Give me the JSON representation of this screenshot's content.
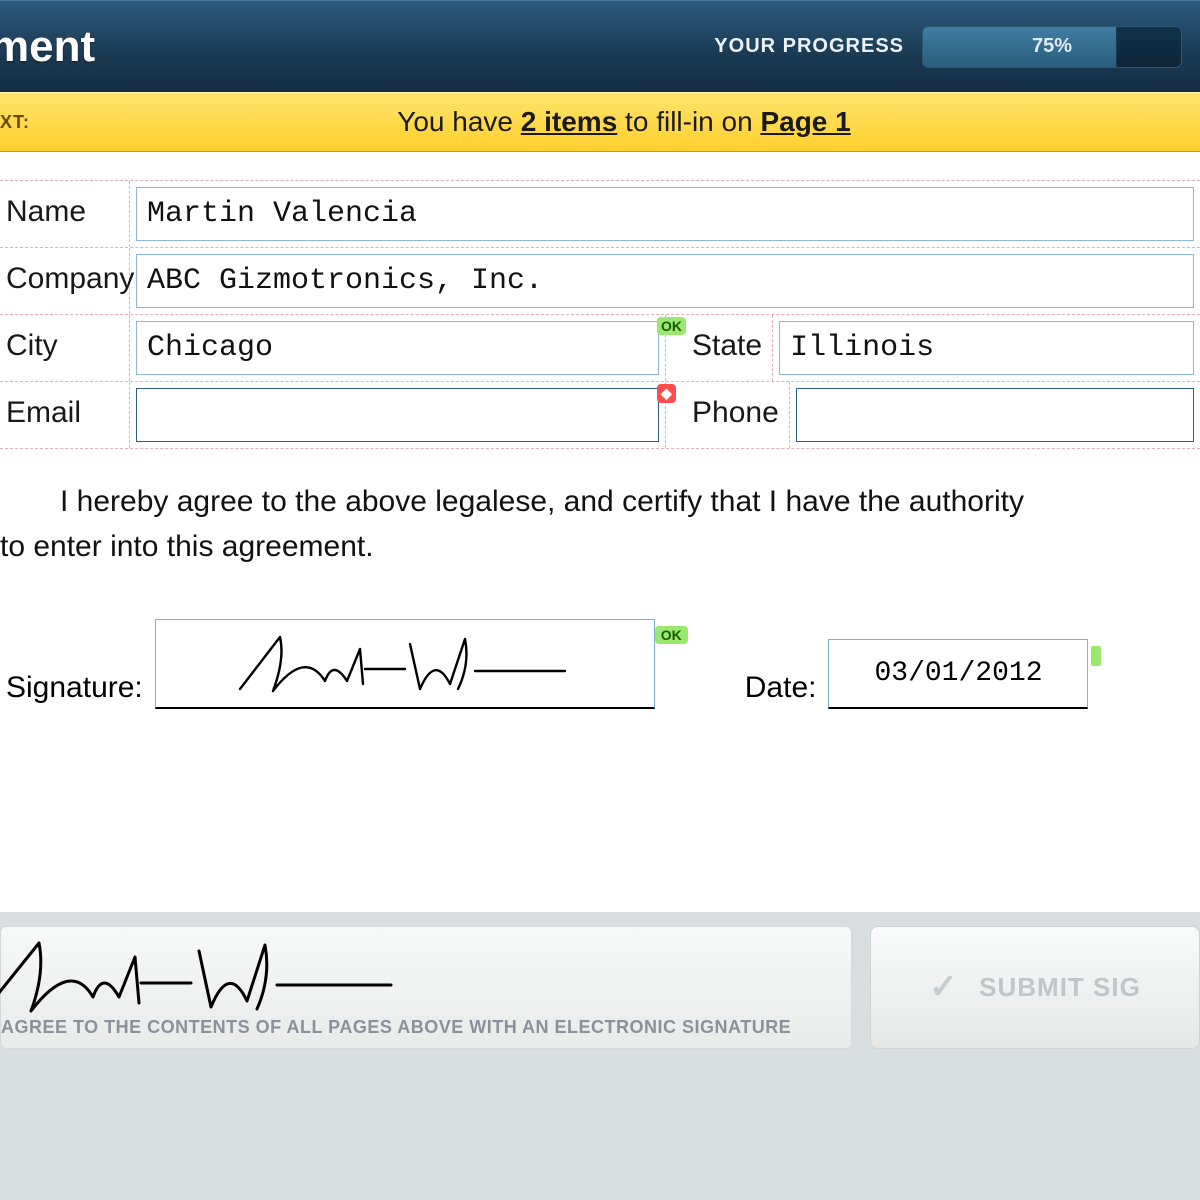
{
  "header": {
    "title_fragment": "ment",
    "progress_label": "YOUR PROGRESS",
    "progress_pct": "75%",
    "progress_fill_pct": 75
  },
  "notice": {
    "prefix": "XT:",
    "pre": "You have ",
    "count": "2 items",
    "mid": " to fill-in on ",
    "page": "Page 1"
  },
  "form": {
    "name_label": "Name",
    "name_value": "Martin Valencia",
    "company_label": "Company",
    "company_value": "ABC Gizmotronics, Inc.",
    "city_label": "City",
    "city_value": "Chicago",
    "state_label": "State",
    "state_value": "Illinois",
    "state_badge": "OK",
    "email_label": "Email",
    "email_value": "",
    "phone_label": "Phone",
    "phone_value": "",
    "agree_text_1": "I hereby agree to the above legalese, and certify that I have the authority",
    "agree_text_2": "to enter into this agreement.",
    "signature_label": "Signature:",
    "signature_ok": "OK",
    "date_label": "Date:",
    "date_value": "03/01/2012"
  },
  "footer": {
    "note": "AGREE TO THE CONTENTS OF ALL PAGES ABOVE WITH AN ELECTRONIC SIGNATURE",
    "submit_label": "SUBMIT SIG"
  }
}
